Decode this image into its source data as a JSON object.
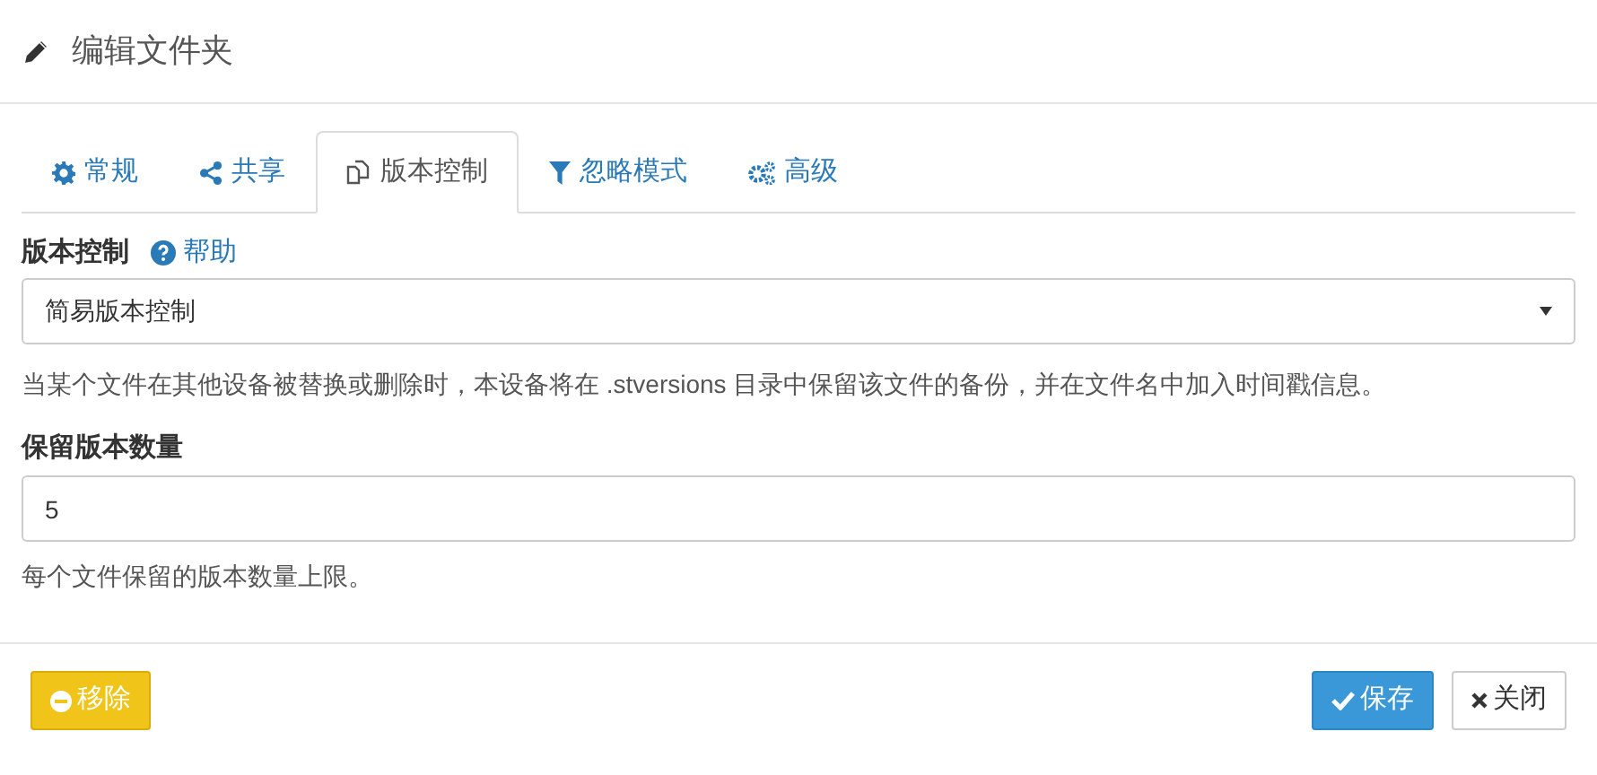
{
  "dialog": {
    "title": "编辑文件夹"
  },
  "tabs": [
    {
      "label": "常规",
      "selected": false
    },
    {
      "label": "共享",
      "selected": false
    },
    {
      "label": "版本控制",
      "selected": true
    },
    {
      "label": "忽略模式",
      "selected": false
    },
    {
      "label": "高级",
      "selected": false
    }
  ],
  "versioning": {
    "label": "版本控制",
    "help_link": "帮助",
    "value": "简易版本控制",
    "description": "当某个文件在其他设备被替换或删除时，本设备将在 .stversions 目录中保留该文件的备份，并在文件名中加入时间戳信息。"
  },
  "keep_versions": {
    "label": "保留版本数量",
    "value": "5",
    "hint": "每个文件保留的版本数量上限。"
  },
  "buttons": [
    {
      "label": "移除",
      "kind": "remove"
    },
    {
      "label": "保存",
      "kind": "save"
    },
    {
      "label": "关闭",
      "kind": "close"
    }
  ]
}
